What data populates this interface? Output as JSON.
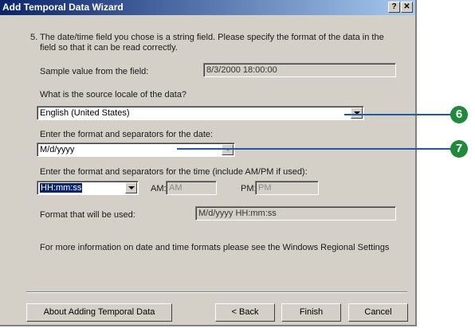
{
  "window": {
    "title": "Add Temporal Data Wizard",
    "help_label": "?",
    "close_label": "✕"
  },
  "step": {
    "number": "5.",
    "text_line1": "The date/time field you chose is a string field.  Please specify the format of the data in the",
    "text_line2": "field so that it can be read correctly."
  },
  "sample": {
    "label": "Sample value from the field:",
    "value": "8/3/2000 18:00:00"
  },
  "locale": {
    "label": "What is the source locale of the data?",
    "value": "English (United States)"
  },
  "date_format": {
    "label": "Enter the format and separators for the date:",
    "value": "M/d/yyyy"
  },
  "time_format": {
    "label": "Enter the format and separators for the time (include AM/PM if used):",
    "value": "HH:mm:ss",
    "am_label": "AM:",
    "am_value": "AM",
    "pm_label": "PM:",
    "pm_value": "PM"
  },
  "result": {
    "label": "Format that will be used:",
    "value": "M/d/yyyy HH:mm:ss"
  },
  "info_text": "For more information on date and time formats please see the Windows Regional Settings",
  "buttons": {
    "about": "About Adding Temporal Data",
    "back": "< Back",
    "finish": "Finish",
    "cancel": "Cancel"
  },
  "callouts": {
    "first": "6",
    "second": "7",
    "color": "#1f8a3a",
    "line_color": "#1d5aa6"
  }
}
